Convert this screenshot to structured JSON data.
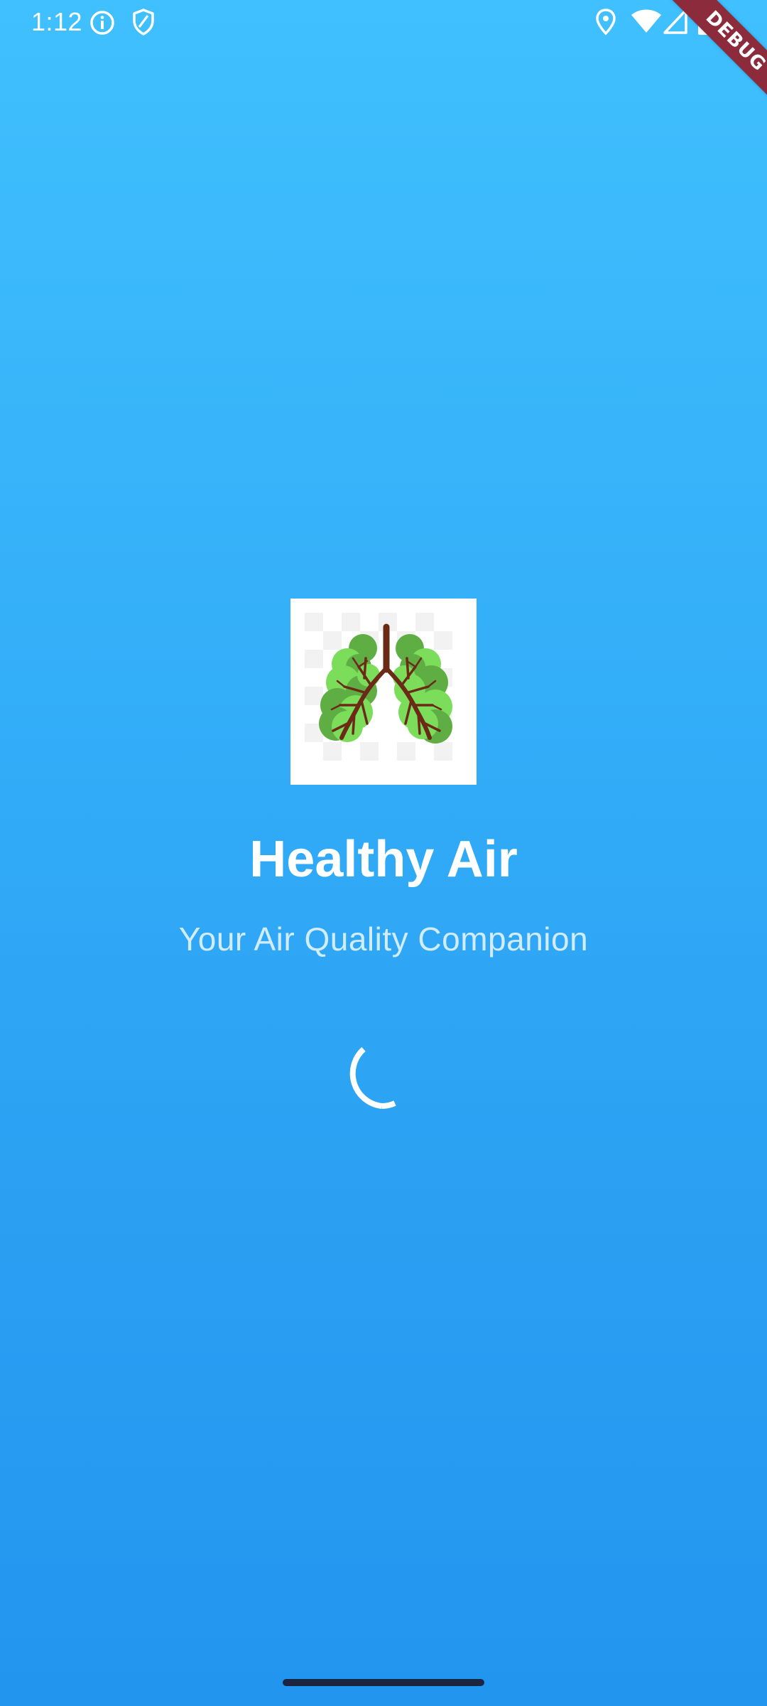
{
  "status_bar": {
    "time": "1:12",
    "icons": [
      "info-circle-icon",
      "shield-icon",
      "location-pin-icon",
      "wifi-icon",
      "cellular-signal-icon",
      "battery-icon"
    ]
  },
  "debug_banner": {
    "label": "DEBUG"
  },
  "splash": {
    "logo_icon": "lungs-tree-icon",
    "title": "Healthy Air",
    "subtitle": "Your Air Quality Companion",
    "loading_indicator": "circular-progress-spinner"
  },
  "colors": {
    "background_top": "#40C0FE",
    "background_bottom": "#2296EF",
    "text": "#FFFFFF",
    "debug_ribbon": "#8B2B3C",
    "lung_leaf_light": "#7BDD5A",
    "lung_leaf_dark": "#5FAE44",
    "bronchi": "#6B2A16"
  }
}
